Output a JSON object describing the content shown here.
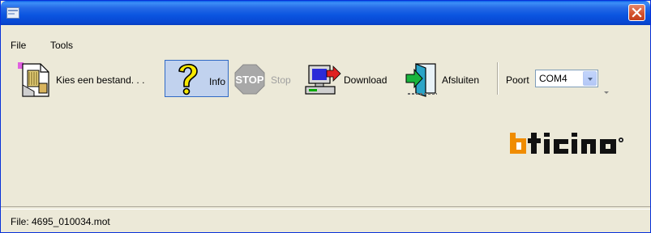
{
  "menu": {
    "file": "File",
    "tools": "Tools"
  },
  "toolbar": {
    "choose_file": "Kies een bestand. . .",
    "info": "Info",
    "stop": "Stop",
    "download": "Download",
    "exit": "Afsluiten",
    "port_label": "Poort",
    "port_value": "COM4"
  },
  "logo": {
    "text": "bticino"
  },
  "status": {
    "file": "File: 4695_010034.mot"
  },
  "colors": {
    "title_blue": "#0a54e0",
    "close_red": "#d3502b",
    "logo_orange": "#f08c00",
    "highlight": "#c1d2ee"
  },
  "icons": [
    "app-icon",
    "close-icon",
    "choose-file-icon",
    "help-icon",
    "stop-sign-icon",
    "download-computer-icon",
    "exit-door-icon",
    "dropdown-arrow-icon"
  ]
}
